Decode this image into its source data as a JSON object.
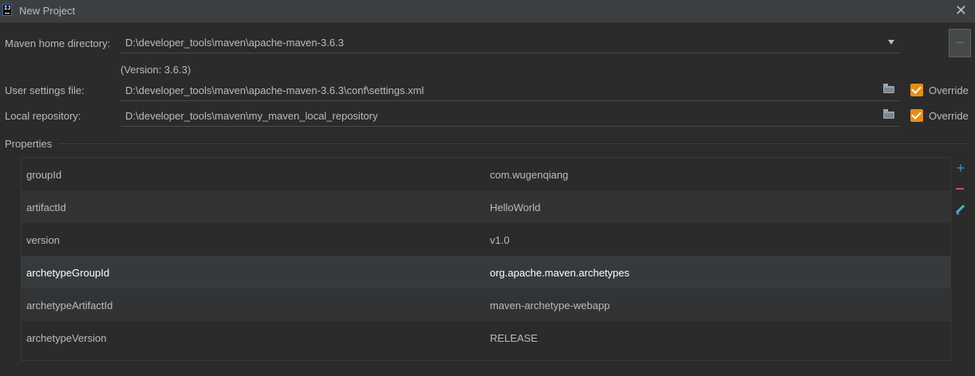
{
  "window": {
    "title": "New Project",
    "close_label": "✕"
  },
  "maven_home": {
    "label": "Maven home directory:",
    "value": "D:\\developer_tools\\maven\\apache-maven-3.6.3",
    "version": "(Version: 3.6.3)",
    "browse_label": "..."
  },
  "user_settings": {
    "label": "User settings file:",
    "value": "D:\\developer_tools\\maven\\apache-maven-3.6.3\\conf\\settings.xml",
    "override_label": "Override",
    "override_checked": true
  },
  "local_repo": {
    "label": "Local repository:",
    "value": "D:\\developer_tools\\maven\\my_maven_local_repository",
    "override_label": "Override",
    "override_checked": true
  },
  "properties": {
    "title": "Properties",
    "rows": [
      {
        "key": "groupId",
        "value": "com.wugenqiang"
      },
      {
        "key": "artifactId",
        "value": "HelloWorld"
      },
      {
        "key": "version",
        "value": "v1.0"
      },
      {
        "key": "archetypeGroupId",
        "value": "org.apache.maven.archetypes"
      },
      {
        "key": "archetypeArtifactId",
        "value": "maven-archetype-webapp"
      },
      {
        "key": "archetypeVersion",
        "value": "RELEASE"
      }
    ],
    "selected_index": 3,
    "tools": [
      "add-icon",
      "remove-icon",
      "edit-icon"
    ]
  },
  "colors": {
    "background": "#2b2b2b",
    "titlebar": "#3c3f41",
    "checkbox_accent": "#e48e17",
    "add": "#3592c4",
    "remove": "#c75450",
    "edit": "#4eb0c9"
  }
}
